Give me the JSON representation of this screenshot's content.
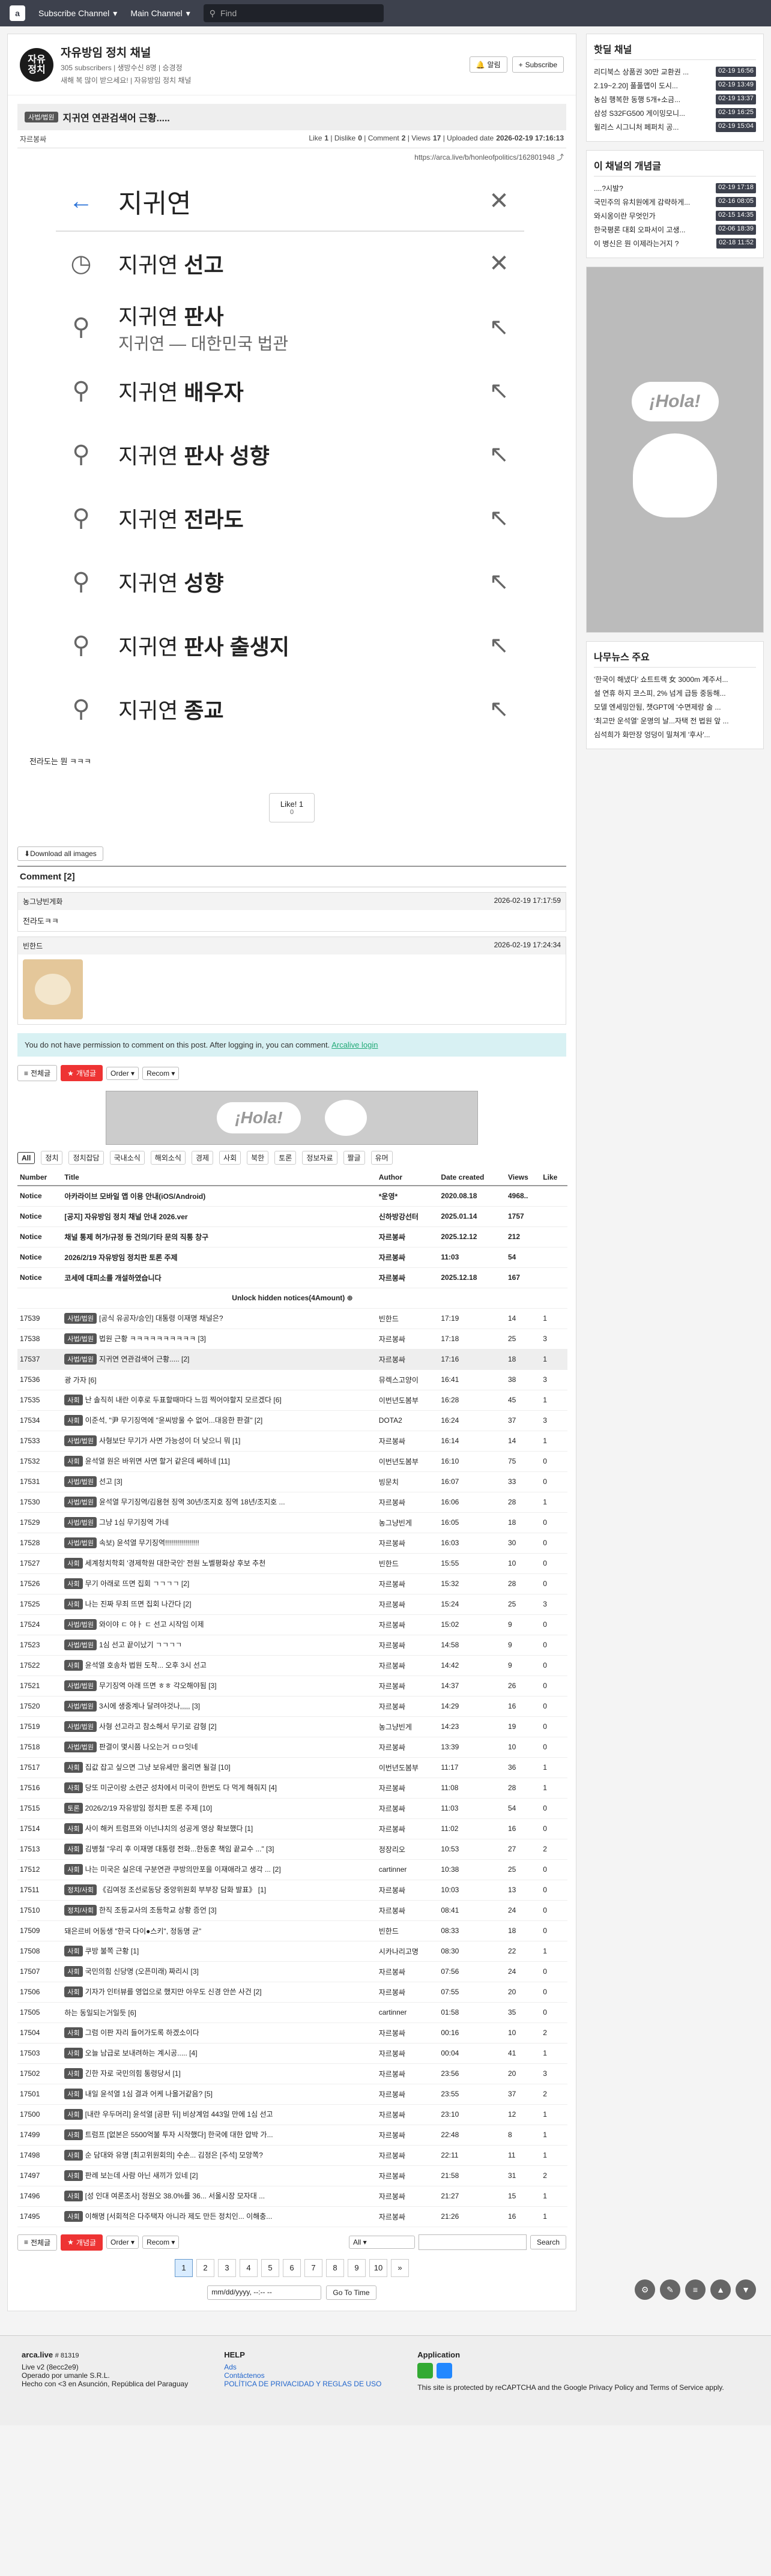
{
  "topbar": {
    "logo": "a",
    "subscribe_channel": "Subscribe Channel",
    "main_channel": "Main Channel",
    "search_placeholder": "Find"
  },
  "channel": {
    "logo_text": "자유\n정치",
    "name": "자유방임 정치 채널",
    "subs": "305 subscribers",
    "owner_note": "| 생방수신 8명 | 승경정",
    "desc": "새해 복 많이 받으세요! | 자유방임 정치 채널",
    "alarm": "알림",
    "subscribe": "Subscribe"
  },
  "article": {
    "category": "사법/법원",
    "title": "지귀연 연관검색어 근황.....",
    "author": "자르봉싸",
    "like_label": "Like",
    "like": "1",
    "dislike_label": "Dislike",
    "dislike": "0",
    "comment_label": "Comment",
    "comment": "2",
    "views_label": "Views",
    "views": "17",
    "date_label": "Uploaded date",
    "date": "2026-02-19 17:16:13",
    "url": "https://arca.live/b/honleofpolitics/162801948",
    "search_query": "지귀연",
    "suggestions": [
      {
        "pre": "지귀연 ",
        "bold": "선고",
        "sub": "",
        "icon": "clock"
      },
      {
        "pre": "지귀연 ",
        "bold": "판사",
        "sub": "지귀연 — 대한민국 법관",
        "icon": "search"
      },
      {
        "pre": "지귀연 ",
        "bold": "배우자",
        "sub": "",
        "icon": "search"
      },
      {
        "pre": "지귀연 ",
        "bold": "판사 성향",
        "sub": "",
        "icon": "search"
      },
      {
        "pre": "지귀연 ",
        "bold": "전라도",
        "sub": "",
        "icon": "search"
      },
      {
        "pre": "지귀연 ",
        "bold": "성향",
        "sub": "",
        "icon": "search"
      },
      {
        "pre": "지귀연 ",
        "bold": "판사 출생지",
        "sub": "",
        "icon": "search"
      },
      {
        "pre": "지귀연 ",
        "bold": "종교",
        "sub": "",
        "icon": "search"
      }
    ],
    "body": "전라도는 뭔 ㅋㅋㅋ",
    "like_btn": "Like! 1",
    "like_sub": "0",
    "download": "Download all images"
  },
  "comments": {
    "heading": "Comment [2]",
    "items": [
      {
        "author": "농그냥빈게화",
        "date": "2026-02-19 17:17:59",
        "text": "전라도ㅋㅋ"
      },
      {
        "author": "빈한드",
        "date": "2026-02-19 17:24:34",
        "text": ""
      }
    ],
    "perm": "You do not have permission to comment on this post. After logging in, you can comment.",
    "login": "Arcalive login"
  },
  "tools": {
    "all": "전체글",
    "hot": "개념글",
    "order": "Order",
    "recom": "Recom"
  },
  "ad_text": "¡Hola!",
  "cats": [
    "All",
    "정치",
    "정치잡담",
    "국내소식",
    "해외소식",
    "경제",
    "사회",
    "북한",
    "토론",
    "정보자료",
    "짤글",
    "유머"
  ],
  "list": {
    "headers": [
      "Number",
      "Title",
      "Author",
      "Date created",
      "Views",
      "Like"
    ],
    "notices": [
      {
        "n": "Notice",
        "t": "아카라이브 모바일 앱 이용 안내(iOS/Android)",
        "a": "*운영*",
        "d": "2020.08.18",
        "v": "4968..",
        "l": ""
      },
      {
        "n": "Notice",
        "t": "[공지] 자유방임 정치 채널 안내 2026.ver",
        "a": "신하방강선터",
        "d": "2025.01.14",
        "v": "1757",
        "l": ""
      },
      {
        "n": "Notice",
        "t": "채널 통제 허가/규정 등 건의/기타 문의 직통 창구",
        "a": "자르봉싸",
        "d": "2025.12.12",
        "v": "212",
        "l": ""
      },
      {
        "n": "Notice",
        "t": "2026/2/19 자유방임 정치판 토론 주제",
        "a": "자르봉싸",
        "d": "11:03",
        "v": "54",
        "l": ""
      },
      {
        "n": "Notice",
        "t": "코세에 대피소를 개설하였습니다",
        "a": "자르봉싸",
        "d": "2025.12.18",
        "v": "167",
        "l": ""
      }
    ],
    "unlock": "Unlock hidden notices(4Amount)",
    "rows": [
      {
        "n": "17539",
        "c": "사법/법원",
        "t": "[공식 유공자/승인] 대통령 이재명 채널은?",
        "a": "빈한드",
        "d": "17:19",
        "v": "14",
        "l": "1"
      },
      {
        "n": "17538",
        "c": "사법/법원",
        "t": "법원 근황 ㅋㅋㅋㅋㅋㅋㅋㅋㅋㅋ [3]",
        "a": "자르봉싸",
        "d": "17:18",
        "v": "25",
        "l": "3"
      },
      {
        "n": "17537",
        "c": "사법/법원",
        "t": "지귀연 연관검색어 근황..... [2]",
        "a": "자르봉싸",
        "d": "17:16",
        "v": "18",
        "l": "1"
      },
      {
        "n": "17536",
        "c": "",
        "t": "광 가자 [6]",
        "a": "뮤렉스고양이",
        "d": "16:41",
        "v": "38",
        "l": "3"
      },
      {
        "n": "17535",
        "c": "사회",
        "t": "난 솔직히 내란 이후로 두표할때마다 느낌 찍어야할지 모르겠다 [6]",
        "a": "이번년도봄부",
        "d": "16:28",
        "v": "45",
        "l": "1"
      },
      {
        "n": "17534",
        "c": "사회",
        "t": "이준석, \"尹 무기징역에 \"윤씨방울 수 없어...대응한 판결\" [2]",
        "a": "DOTA2",
        "d": "16:24",
        "v": "37",
        "l": "3"
      },
      {
        "n": "17533",
        "c": "사법/법원",
        "t": "사형보단 무기가 사면 가능성이 더 낮으니 뭐 [1]",
        "a": "자르봉싸",
        "d": "16:14",
        "v": "14",
        "l": "1"
      },
      {
        "n": "17532",
        "c": "사회",
        "t": "윤석열 원은 바위면 사면 할거 같은데 쎄하네 [11]",
        "a": "이번년도봄부",
        "d": "16:10",
        "v": "75",
        "l": "0"
      },
      {
        "n": "17531",
        "c": "사법/법원",
        "t": "선고 [3]",
        "a": "빙문치",
        "d": "16:07",
        "v": "33",
        "l": "0"
      },
      {
        "n": "17530",
        "c": "사법/법원",
        "t": "윤석열 무기징역/김용현 징역 30년/조지호 징역 18년/조지호 ...",
        "a": "자르봉싸",
        "d": "16:06",
        "v": "28",
        "l": "1"
      },
      {
        "n": "17529",
        "c": "사법/법원",
        "t": "그냥 1심 무기징역 가네",
        "a": "농그냥빈게",
        "d": "16:05",
        "v": "18",
        "l": "0"
      },
      {
        "n": "17528",
        "c": "사법/법원",
        "t": "속보) 윤석열 무기징역!!!!!!!!!!!!!!!!!",
        "a": "자르봉싸",
        "d": "16:03",
        "v": "30",
        "l": "0"
      },
      {
        "n": "17527",
        "c": "사회",
        "t": "세계청치학회 '경제학원 대한국인' 전원 노벨평화상 후보 추천",
        "a": "빈한드",
        "d": "15:55",
        "v": "10",
        "l": "0"
      },
      {
        "n": "17526",
        "c": "사회",
        "t": "무기 아래로 뜨면 집회 ㄱㄱㄱㄱ [2]",
        "a": "자르봉싸",
        "d": "15:32",
        "v": "28",
        "l": "0"
      },
      {
        "n": "17525",
        "c": "사회",
        "t": "나는 진짜 무죄 뜨면 집회 나간다 [2]",
        "a": "자르봉싸",
        "d": "15:24",
        "v": "25",
        "l": "3"
      },
      {
        "n": "17524",
        "c": "사법/법원",
        "t": "와이야 ㄷ 야ㅏ ㄷ 선고 시작임 이제",
        "a": "자르봉싸",
        "d": "15:02",
        "v": "9",
        "l": "0"
      },
      {
        "n": "17523",
        "c": "사법/법원",
        "t": "1심 선고 끝이났기 ㄱㄱㄱㄱ",
        "a": "자르봉싸",
        "d": "14:58",
        "v": "9",
        "l": "0"
      },
      {
        "n": "17522",
        "c": "사회",
        "t": "윤석열 호송차 법원 도착... 오후 3시 선고",
        "a": "자르봉싸",
        "d": "14:42",
        "v": "9",
        "l": "0"
      },
      {
        "n": "17521",
        "c": "사법/법원",
        "t": "무기징역 아래 뜨면 ㅎㅎ 각오해야됨 [3]",
        "a": "자르봉싸",
        "d": "14:37",
        "v": "26",
        "l": "0"
      },
      {
        "n": "17520",
        "c": "사법/법원",
        "t": "3시에 생중계나 달려야것나,,,,, [3]",
        "a": "자르봉싸",
        "d": "14:29",
        "v": "16",
        "l": "0"
      },
      {
        "n": "17519",
        "c": "사법/법원",
        "t": "사형 선고라고 참소해서 무기로 감형 [2]",
        "a": "농그냥빈게",
        "d": "14:23",
        "v": "19",
        "l": "0"
      },
      {
        "n": "17518",
        "c": "사법/법원",
        "t": "판결이 몇시쯤 나오는거 ㅁㅁ잇네",
        "a": "자르봉싸",
        "d": "13:39",
        "v": "10",
        "l": "0"
      },
      {
        "n": "17517",
        "c": "사회",
        "t": "집값 잡고 싶으면 그냥 보유세만 올리면 될걸 [10]",
        "a": "이번년도봄부",
        "d": "11:17",
        "v": "36",
        "l": "1"
      },
      {
        "n": "17516",
        "c": "사회",
        "t": "당또 미군이랑 소련군 성차에서 미국이 한번도 다 먹게 해줘지 [4]",
        "a": "자르봉싸",
        "d": "11:08",
        "v": "28",
        "l": "1"
      },
      {
        "n": "17515",
        "c": "토론",
        "t": "2026/2/19 자유방임 정치판 토론 주제 [10]",
        "a": "자르봉싸",
        "d": "11:03",
        "v": "54",
        "l": "0"
      },
      {
        "n": "17514",
        "c": "사회",
        "t": "사이 해커 트럼프와 이넌냐치의 성공게 영상 확보했다 [1]",
        "a": "자르봉싸",
        "d": "11:02",
        "v": "16",
        "l": "0"
      },
      {
        "n": "17513",
        "c": "사회",
        "t": "김병철 \"우리 후 이재명 대통령 전화...한동훈 책임 끝교수 ...\" [3]",
        "a": "정장리오",
        "d": "10:53",
        "v": "27",
        "l": "2"
      },
      {
        "n": "17512",
        "c": "사회",
        "t": "나는 미국은 실은데 구분연관 쿠방의만포을 이재애라고 생각 ... [2]",
        "a": "cartinner",
        "d": "10:38",
        "v": "25",
        "l": "0"
      },
      {
        "n": "17511",
        "c": "정치/사회",
        "t": "《김여정 조선로동당 중앙위원회 부부장 담화 발표》 [1]",
        "a": "자르봉싸",
        "d": "10:03",
        "v": "13",
        "l": "0"
      },
      {
        "n": "17510",
        "c": "정치/사회",
        "t": "한직 조등교사의 조등학교 상황 증언 [3]",
        "a": "자르봉싸",
        "d": "08:41",
        "v": "24",
        "l": "0"
      },
      {
        "n": "17509",
        "c": "",
        "t": "돼은르비 어동생 \"한국 다이●스키\", 정동명 균\"",
        "a": "빈한드",
        "d": "08:33",
        "v": "18",
        "l": "0"
      },
      {
        "n": "17508",
        "c": "사회",
        "t": "쿠방 불쪽 근황 [1]",
        "a": "시카나리고명",
        "d": "08:30",
        "v": "22",
        "l": "1"
      },
      {
        "n": "17507",
        "c": "사회",
        "t": "국민의힘 신당명 (오픈미래) 짜리시 [3]",
        "a": "자르봉싸",
        "d": "07:56",
        "v": "24",
        "l": "0"
      },
      {
        "n": "17506",
        "c": "사회",
        "t": "기자가 인터뷰를 영업으로 했지만 아우도 신경 안쓴 사건 [2]",
        "a": "자르봉싸",
        "d": "07:55",
        "v": "20",
        "l": "0"
      },
      {
        "n": "17505",
        "c": "",
        "t": "하는 동일되는거일듯 [6]",
        "a": "cartinner",
        "d": "01:58",
        "v": "35",
        "l": "0"
      },
      {
        "n": "17504",
        "c": "사회",
        "t": "그럼 이판 자리 들어가도록 하겠소이다",
        "a": "자르봉싸",
        "d": "00:16",
        "v": "10",
        "l": "2"
      },
      {
        "n": "17503",
        "c": "사회",
        "t": "오늘 남급로 보내려하는 계시공..... [4]",
        "a": "자르봉싸",
        "d": "00:04",
        "v": "41",
        "l": "1"
      },
      {
        "n": "17502",
        "c": "사회",
        "t": "긴한 자로 국민의힘 통령당서 [1]",
        "a": "자르봉싸",
        "d": "23:56",
        "v": "20",
        "l": "3"
      },
      {
        "n": "17501",
        "c": "사회",
        "t": "내일 윤석열 1심 결과 어케 나올거같음? [5]",
        "a": "자르봉싸",
        "d": "23:55",
        "v": "37",
        "l": "2"
      },
      {
        "n": "17500",
        "c": "사회",
        "t": "[내란 우두머리] 윤석열 [공판 뒤] 비상계엄 443일 만에 1심 선고",
        "a": "자르봉싸",
        "d": "23:10",
        "v": "12",
        "l": "1"
      },
      {
        "n": "17499",
        "c": "사회",
        "t": "트럼프 [없본은 5500억불 투자 시작했다] 한국에 대한 압박 가...",
        "a": "자르봉싸",
        "d": "22:48",
        "v": "8",
        "l": "1"
      },
      {
        "n": "17498",
        "c": "사회",
        "t": "순 담대와 유명 [최고위원회의] 수손... 김정은 [주석] 모앙쪽?",
        "a": "자르봉싸",
        "d": "22:11",
        "v": "11",
        "l": "1"
      },
      {
        "n": "17497",
        "c": "사회",
        "t": "판례 보는데 사람 아닌 새끼가 있네 [2]",
        "a": "자르봉싸",
        "d": "21:58",
        "v": "31",
        "l": "2"
      },
      {
        "n": "17496",
        "c": "사회",
        "t": "[성 인대 여론조사] 정원오 38.0%를 36... 서울시장 모자대 ...",
        "a": "자르봉싸",
        "d": "21:27",
        "v": "15",
        "l": "1"
      },
      {
        "n": "17495",
        "c": "사회",
        "t": "이해명 [서회적은 다주택자 아니라 제도 만든 정치인... 이해충...",
        "a": "자르봉싸",
        "d": "21:26",
        "v": "16",
        "l": "1"
      }
    ]
  },
  "search": {
    "scope": "All",
    "button": "Search"
  },
  "pages": [
    "1",
    "2",
    "3",
    "4",
    "5",
    "6",
    "7",
    "8",
    "9",
    "10"
  ],
  "date_placeholder": "mm/dd/yyyy, --:-- --",
  "goto": "Go To Time",
  "sidebar": {
    "hot_title": "핫딜 채널",
    "hot": [
      {
        "t": "리디북스 상품권 30만 교환권 ...",
        "tm": "02-19 16:56"
      },
      {
        "t": "2.19~2.20] 풀풀맵이 도시...",
        "tm": "02-19 13:49"
      },
      {
        "t": "농심 행복한 동행 5개+소금...",
        "tm": "02-19 13:37"
      },
      {
        "t": "삼성 S32FG500 게이밍모니...",
        "tm": "02-19 16:25"
      },
      {
        "t": "윌리스 시그니처 페퍼치 공...",
        "tm": "02-19 15:04"
      }
    ],
    "best_title": "이 채널의 개념글",
    "best": [
      {
        "t": "....?시발?",
        "tm": "02-19 17:18"
      },
      {
        "t": "국민주의 유치원에게 감략하게...",
        "tm": "02-16 08:05"
      },
      {
        "t": "와시옹이란 무엇인가",
        "tm": "02-15 14:35"
      },
      {
        "t": "한국평론 대회 오파서이 고생...",
        "tm": "02-06 18:39"
      },
      {
        "t": "이 병신은 뭔 이제라는거지 ?",
        "tm": "02-18 11:52"
      }
    ],
    "news_title": "나무뉴스 주요",
    "news": [
      "'한국이 해냈다' 쇼트트랙 女 3000m 계주서...",
      "설 연휴 하지 코스피, 2% 넘게 급등 중동해...",
      "모델 엔세밍안됨, 챗GPT에 '수면제랑 술 ...",
      "'최고만 운석열' 운명의 날...자택 전 법원 앞 ...",
      "심석희가 화만장 엉덩이 밀쳐게 '후사'..."
    ]
  },
  "footer": {
    "brand": "arca.live",
    "count": "# 81319",
    "line1": "Live v2 (8ecc2e9)",
    "line2": "Operado por umanle S.R.L.",
    "line3": "Hecho con <3 en Asunción, República del Paraguay",
    "help": "HELP",
    "ads": "Ads",
    "contact": "Contáctenos",
    "policy": "POLÍTICA DE PRIVACIDAD Y REGLAS DE USO",
    "app": "Application",
    "recaptcha": "This site is protected by reCAPTCHA and the Google Privacy Policy and Terms of Service apply."
  }
}
